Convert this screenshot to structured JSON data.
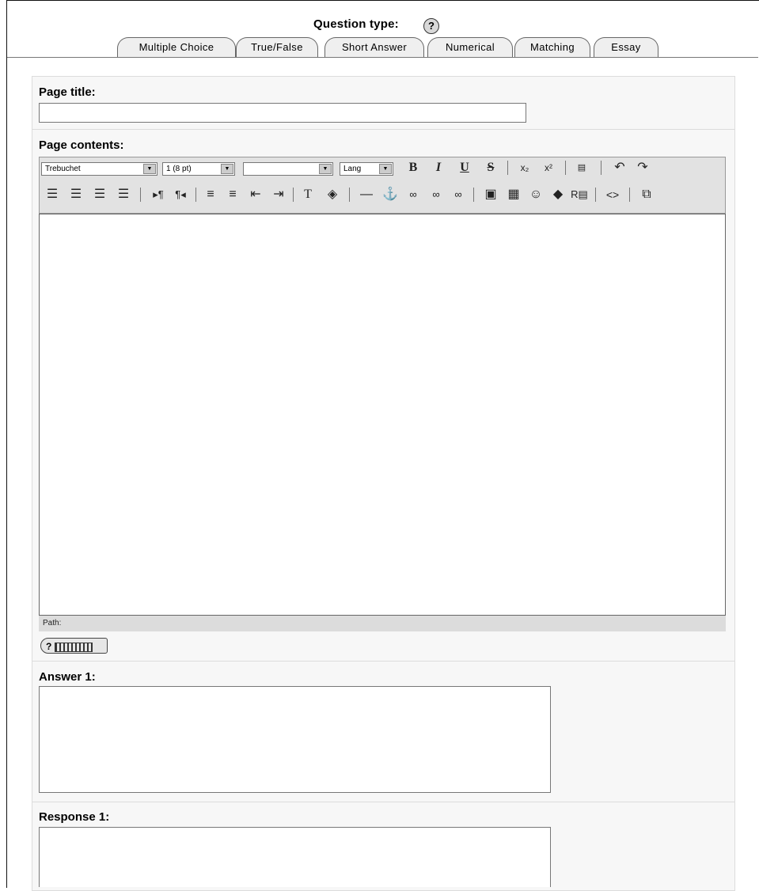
{
  "question_type": {
    "heading": "Question type:",
    "help_icon": "help-icon",
    "tabs": [
      {
        "label": "Multiple Choice"
      },
      {
        "label": "True/False"
      },
      {
        "label": "Short Answer"
      },
      {
        "label": "Numerical"
      },
      {
        "label": "Matching"
      },
      {
        "label": "Essay"
      }
    ]
  },
  "form": {
    "page_title": {
      "label": "Page title:",
      "value": ""
    },
    "page_contents": {
      "label": "Page contents:",
      "value": ""
    },
    "answer_1": {
      "label": "Answer 1:",
      "value": ""
    },
    "response_1": {
      "label": "Response 1:",
      "value": ""
    }
  },
  "editor": {
    "font_select": "Trebuchet",
    "size_select": "1 (8 pt)",
    "format_select": "",
    "lang_select": "Lang",
    "path_label": "Path:",
    "toolbar_row1": [
      "bold-icon",
      "italic-icon",
      "underline-icon",
      "strikethrough-icon",
      "subscript-icon",
      "superscript-icon",
      "clean-word-icon",
      "undo-icon",
      "redo-icon"
    ],
    "toolbar_row2": [
      "align-left-icon",
      "align-center-icon",
      "align-right-icon",
      "justify-icon",
      "ltr-icon",
      "rtl-icon",
      "ordered-list-icon",
      "unordered-list-icon",
      "outdent-icon",
      "indent-icon",
      "text-color-icon",
      "background-color-icon",
      "horizontal-rule-icon",
      "anchor-icon",
      "link-icon",
      "unlink-icon",
      "nolink-icon",
      "insert-image-icon",
      "insert-table-icon",
      "smiley-icon",
      "special-char-icon",
      "search-replace-icon",
      "html-source-icon",
      "fullscreen-icon"
    ]
  }
}
